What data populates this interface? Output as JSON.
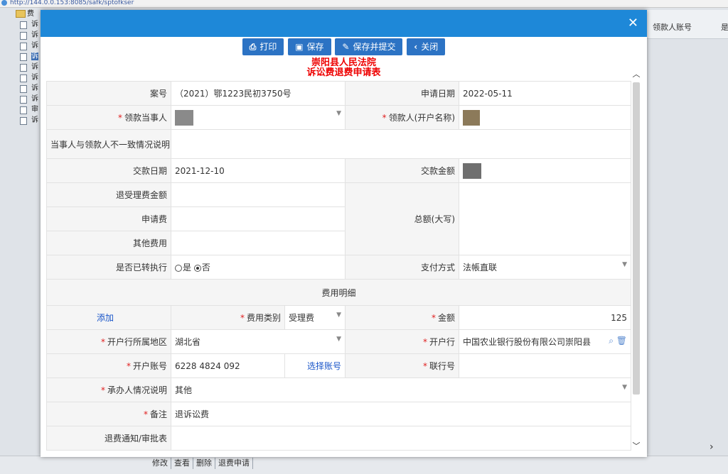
{
  "address_bar": {
    "url": "http://144.0.0.153:8085/safk/sptofkser"
  },
  "tree": {
    "root": "费",
    "items": [
      "诉",
      "诉",
      "诉",
      "诉",
      "诉",
      "诉",
      "诉",
      "诉",
      "审",
      "诉"
    ]
  },
  "background": {
    "col_payee_account": "领款人账号",
    "col_last": "是",
    "bottom_tabs": [
      "修改",
      "查看",
      "删除",
      "退费申请"
    ]
  },
  "modal": {
    "close_glyph": "✕",
    "toolbar": {
      "print": "打印",
      "save": "保存",
      "save_submit": "保存并提交",
      "close": "关闭"
    },
    "court_name": "崇阳县人民法院",
    "form_title": "诉讼费退费申请表",
    "form": {
      "case_no_label": "案号",
      "case_no": "（2021）鄂1223民初3750号",
      "apply_date_label": "申请日期",
      "apply_date": "2022-05-11",
      "party_label": "领款当事人",
      "payee_label": "领款人(开户名称)",
      "mismatch_label": "当事人与领款人不一致情况说明",
      "pay_date_label": "交款日期",
      "pay_date": "2021-12-10",
      "pay_amount_label": "交款金额",
      "refund_fee_label": "退受理费金额",
      "total_label": "总额(大写)",
      "apply_fee_label": "申请费",
      "other_fee_label": "其他费用",
      "transferred_label": "是否已转执行",
      "opt_yes": "是",
      "opt_no": "否",
      "pay_method_label": "支付方式",
      "pay_method": "法帳直联",
      "detail_title": "费用明细",
      "add_link": "添加",
      "fee_type_label": "费用类别",
      "fee_type": "受理费",
      "amount_label": "金额",
      "amount": "125",
      "bank_region_label": "开户行所属地区",
      "bank_region": "湖北省",
      "bank_label": "开户行",
      "bank": "中国农业银行股份有限公司崇阳县",
      "account_label": "开户账号",
      "account": "6228 4824 092",
      "choose_account": "选择账号",
      "link_no_label": "联行号",
      "handler_label": "承办人情况说明",
      "handler": "其他",
      "remark_label": "备注",
      "remark": "退诉讼费",
      "notice_label": "退费通知/审批表"
    }
  },
  "colors": {
    "header_blue": "#1e88d8",
    "button_blue": "#2c73c4",
    "required_red": "#e02020",
    "title_red": "#e00000"
  }
}
